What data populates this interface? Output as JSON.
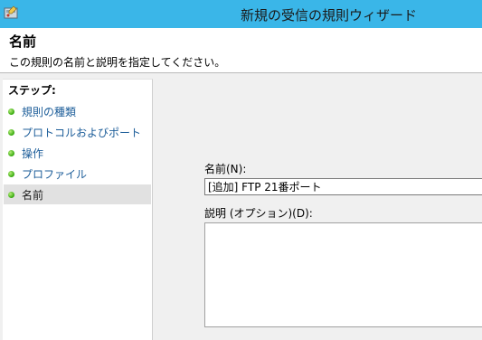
{
  "window": {
    "title": "新規の受信の規則ウィザード",
    "app_icon": "firewall-wizard-icon"
  },
  "header": {
    "title": "名前",
    "description": "この規則の名前と説明を指定してください。"
  },
  "steps": {
    "heading": "ステップ:",
    "items": [
      {
        "label": "規則の種類",
        "active": false
      },
      {
        "label": "プロトコルおよびポート",
        "active": false
      },
      {
        "label": "操作",
        "active": false
      },
      {
        "label": "プロファイル",
        "active": false
      },
      {
        "label": "名前",
        "active": true
      }
    ]
  },
  "form": {
    "name_label": "名前(N):",
    "name_value": "[追加] FTP 21番ポート",
    "description_label": "説明 (オプション)(D):",
    "description_value": ""
  },
  "colors": {
    "titlebar": "#3ab6e8",
    "step_link": "#1c5d99",
    "step_dot": "#34a80c",
    "active_step_bg": "#e1e1e1"
  }
}
